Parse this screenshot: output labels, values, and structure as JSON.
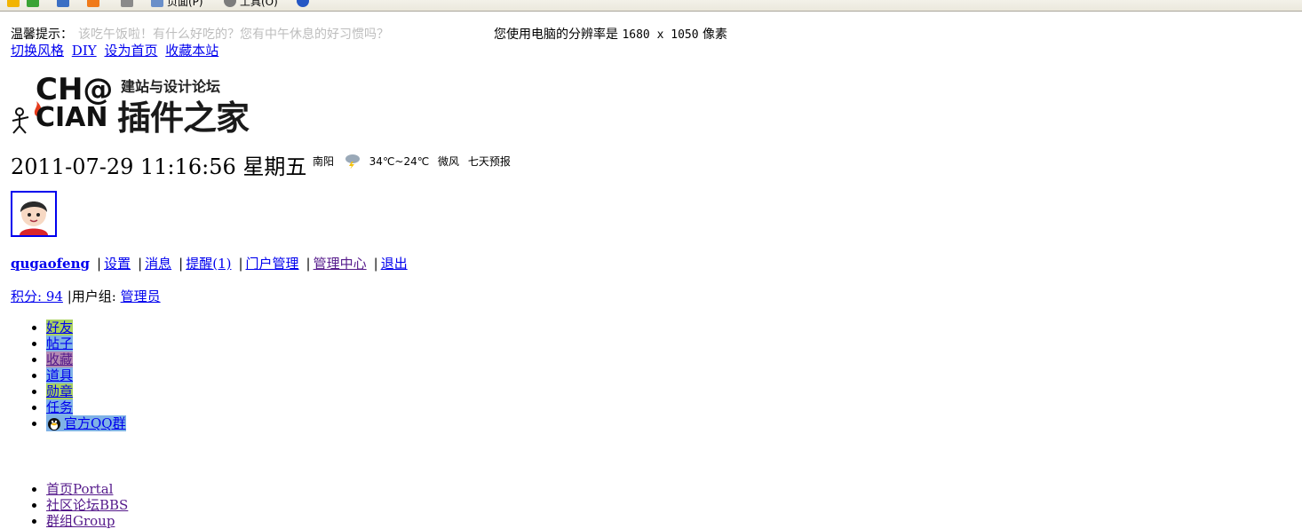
{
  "browser": {
    "toolbar_items": [
      "页面(P)",
      "工具(O)"
    ]
  },
  "header": {
    "tip_label": "温馨提示：",
    "tip_text": "该吃午饭啦！有什么好吃的？您有中午休息的好习惯吗？",
    "resolution_prefix": "您使用电脑的分辨率是",
    "resolution_value": "1680 x 1050",
    "resolution_suffix": "像素"
  },
  "top_links": [
    "切换风格",
    "DIY",
    "设为首页",
    "收藏本站"
  ],
  "logo": {
    "letters_top": "CH@",
    "letters_bottom": "CIAN",
    "slogan": "建站与设计论坛",
    "name": "插件之家"
  },
  "clock": {
    "datetime": "2011-07-29 11:16:56",
    "weekday": "星期五"
  },
  "weather": {
    "city": "南阳",
    "icon": "thunderstorm-icon",
    "temperature": "34℃~24℃",
    "wind": "微风",
    "forecast_link": "七天预报"
  },
  "user": {
    "avatar_icon": "boy-avatar-icon",
    "username": "qugaofeng",
    "links": [
      "设置",
      "消息",
      "提醒(1)",
      "门户管理",
      "管理中心",
      "退出"
    ],
    "credits_label": "积分: 94",
    "group_label": "用户组: ",
    "group_value": "管理员"
  },
  "tabs": [
    {
      "label": "好友",
      "bg": "#a9d15f"
    },
    {
      "label": "帖子",
      "bg": "#7fb2e6"
    },
    {
      "label": "收藏",
      "bg": "#b48ab4"
    },
    {
      "label": "道具",
      "bg": "#7fb2e6"
    },
    {
      "label": "勋章",
      "bg": "#a9d15f"
    },
    {
      "label": "任务",
      "bg": "#7fb2e6"
    },
    {
      "label": "官方QQ群",
      "bg": "#7fb2e6"
    }
  ],
  "nav": [
    {
      "label": "首页Portal"
    },
    {
      "label": "社区论坛BBS"
    },
    {
      "label": "群组Group"
    }
  ]
}
